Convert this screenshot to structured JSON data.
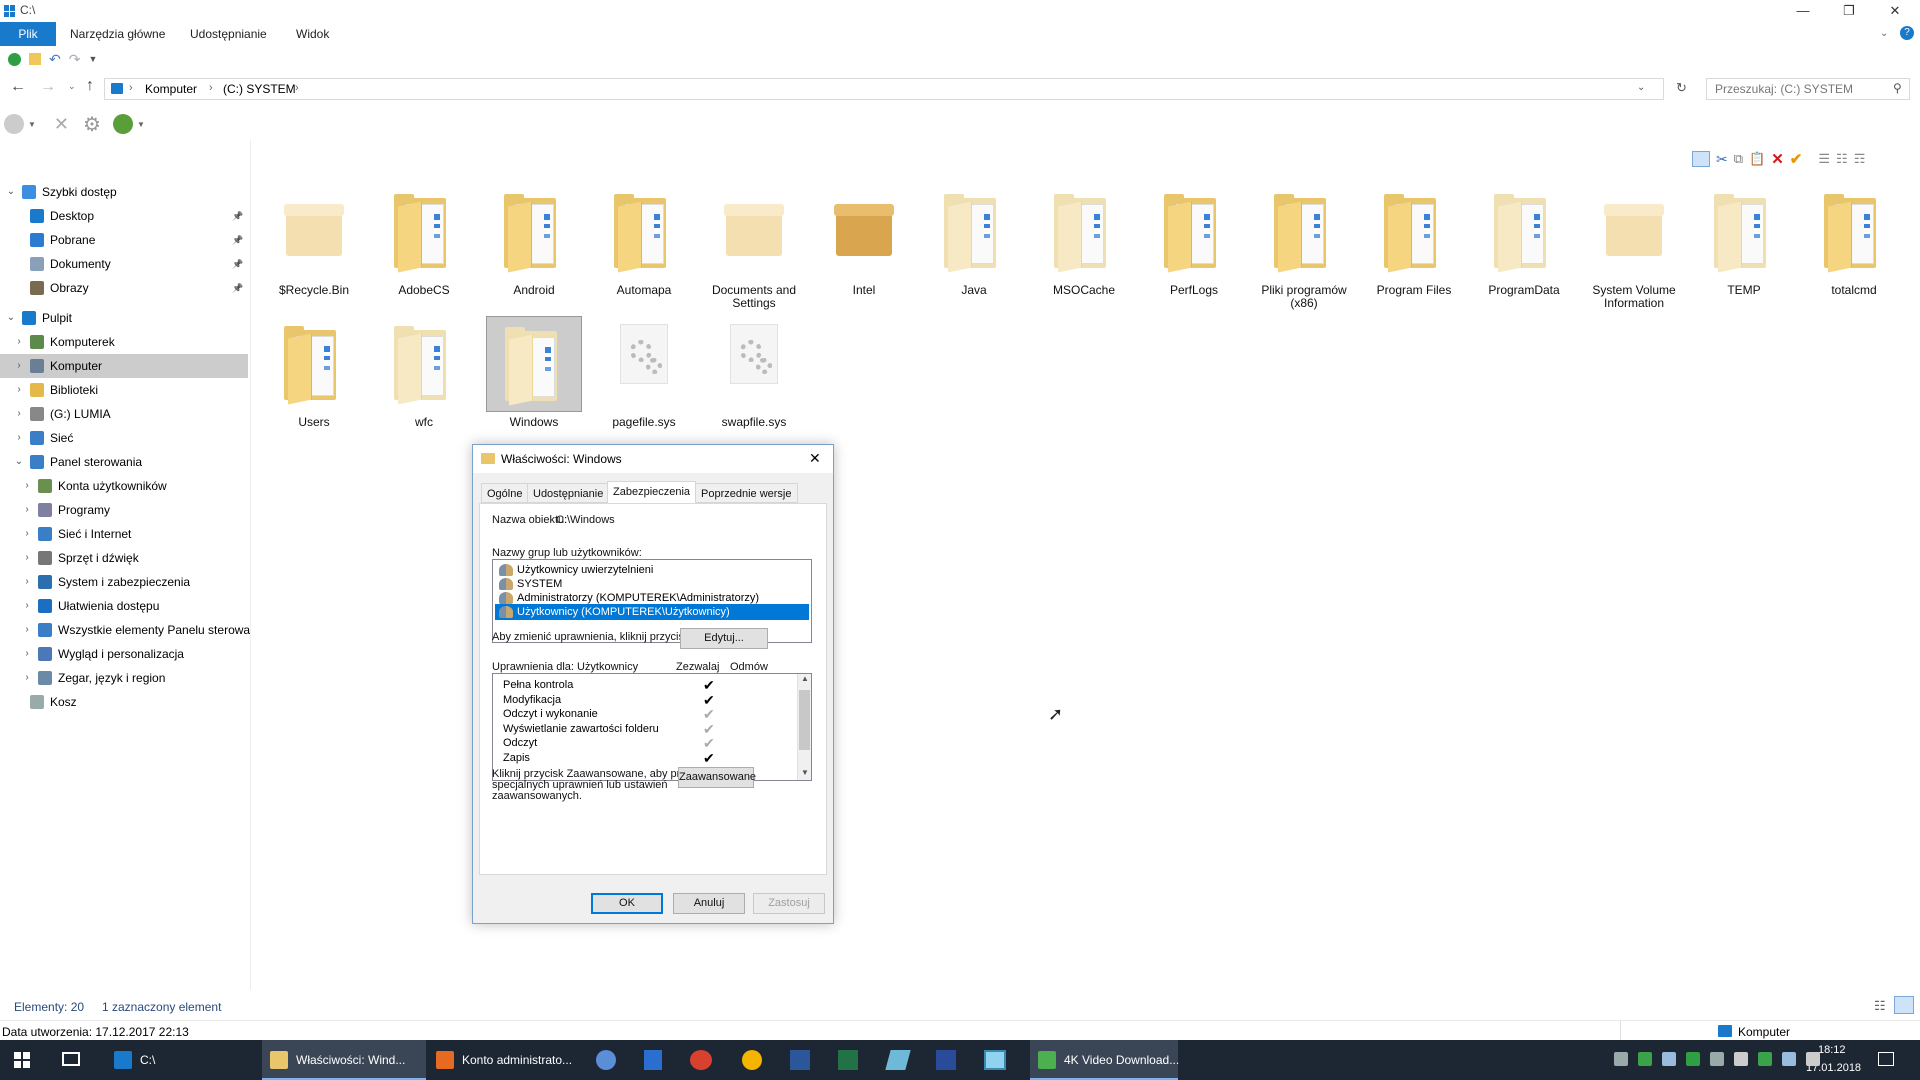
{
  "window": {
    "title": "C:\\",
    "minimize": "—",
    "restore": "❐",
    "close": "✕"
  },
  "ribbon": {
    "tabs": [
      "Plik",
      "Narzędzia główne",
      "Udostępnianie",
      "Widok"
    ]
  },
  "address": {
    "path": [
      "Komputer",
      "(C:) SYSTEM"
    ],
    "search_placeholder": "Przeszukaj: (C:) SYSTEM"
  },
  "nav": [
    {
      "label": "Szybki dostęp",
      "level": 0,
      "exp": "open",
      "color": "#3b8ee0"
    },
    {
      "label": "Desktop",
      "level": 1,
      "pin": true,
      "color": "#1979ca"
    },
    {
      "label": "Pobrane",
      "level": 1,
      "pin": true,
      "color": "#2b7bd3"
    },
    {
      "label": "Dokumenty",
      "level": 1,
      "pin": true,
      "color": "#8aa0b8"
    },
    {
      "label": "Obrazy",
      "level": 1,
      "pin": true,
      "color": "#7a6a50"
    },
    {
      "label": "Pulpit",
      "level": 0,
      "exp": "open",
      "color": "#1979ca",
      "gap": true
    },
    {
      "label": "Komputerek",
      "level": 1,
      "exp": "closed",
      "color": "#5b8a4a"
    },
    {
      "label": "Komputer",
      "level": 1,
      "exp": "closed",
      "color": "#6a7f95",
      "sel": true
    },
    {
      "label": "Biblioteki",
      "level": 1,
      "exp": "closed",
      "color": "#e5b84a"
    },
    {
      "label": "(G:) LUMIA",
      "level": 1,
      "exp": "closed",
      "color": "#888"
    },
    {
      "label": "Sieć",
      "level": 1,
      "exp": "closed",
      "color": "#3b7ec8"
    },
    {
      "label": "Panel sterowania",
      "level": 1,
      "exp": "open",
      "color": "#3b7ec8"
    },
    {
      "label": "Konta użytkowników",
      "level": 2,
      "exp": "closed",
      "color": "#6b8f4e"
    },
    {
      "label": "Programy",
      "level": 2,
      "exp": "closed",
      "color": "#7f7f9f"
    },
    {
      "label": "Sieć i Internet",
      "level": 2,
      "exp": "closed",
      "color": "#3b7ec8"
    },
    {
      "label": "Sprzęt i dźwięk",
      "level": 2,
      "exp": "closed",
      "color": "#777"
    },
    {
      "label": "System i zabezpieczenia",
      "level": 2,
      "exp": "closed",
      "color": "#2b6fb0"
    },
    {
      "label": "Ułatwienia dostępu",
      "level": 2,
      "exp": "closed",
      "color": "#1b6ec2"
    },
    {
      "label": "Wszystkie elementy Panelu sterowa",
      "level": 2,
      "exp": "closed",
      "color": "#3b7ec8"
    },
    {
      "label": "Wygląd i personalizacja",
      "level": 2,
      "exp": "closed",
      "color": "#4a78b8"
    },
    {
      "label": "Zegar, język i region",
      "level": 2,
      "exp": "closed",
      "color": "#6a8aa8"
    },
    {
      "label": "Kosz",
      "level": 1,
      "color": "#9aa"
    }
  ],
  "files": [
    {
      "name": "$Recycle.Bin",
      "kind": "box"
    },
    {
      "name": "AdobeCS",
      "kind": "folder"
    },
    {
      "name": "Android",
      "kind": "folder"
    },
    {
      "name": "Automapa",
      "kind": "folder"
    },
    {
      "name": "Documents and Settings",
      "kind": "box"
    },
    {
      "name": "Intel",
      "kind": "boxdark"
    },
    {
      "name": "Java",
      "kind": "folderpale"
    },
    {
      "name": "MSOCache",
      "kind": "folderpale"
    },
    {
      "name": "PerfLogs",
      "kind": "folder"
    },
    {
      "name": "Pliki programów (x86)",
      "kind": "folder"
    },
    {
      "name": "Program Files",
      "kind": "folder"
    },
    {
      "name": "ProgramData",
      "kind": "folderpale"
    },
    {
      "name": "System Volume Information",
      "kind": "box"
    },
    {
      "name": "TEMP",
      "kind": "folderpale"
    },
    {
      "name": "totalcmd",
      "kind": "folder"
    },
    {
      "name": "Users",
      "kind": "folder"
    },
    {
      "name": "wfc",
      "kind": "folderpale"
    },
    {
      "name": "Windows",
      "kind": "folderpale",
      "sel": true
    },
    {
      "name": "pagefile.sys",
      "kind": "gear"
    },
    {
      "name": "swapfile.sys",
      "kind": "gear"
    }
  ],
  "dialog": {
    "title": "Właściwości: Windows",
    "close": "✕",
    "tabs": [
      "Ogólne",
      "Udostępnianie",
      "Zabezpieczenia",
      "Poprzednie wersje"
    ],
    "object_label": "Nazwa obiektu:",
    "object_value": "C:\\Windows",
    "groups_label": "Nazwy grup lub użytkowników:",
    "groups": [
      "Użytkownicy uwierzytelnieni",
      "SYSTEM",
      "Administratorzy (KOMPUTEREK\\Administratorzy)",
      "Użytkownicy (KOMPUTEREK\\Użytkownicy)"
    ],
    "change_text": "Aby zmienić uprawnienia, kliknij przycisk Edytuj.",
    "edit_btn": "Edytuj...",
    "perm_label": "Uprawnienia dla: Użytkownicy",
    "allow": "Zezwalaj",
    "deny": "Odmów",
    "perms": [
      {
        "name": "Pełna kontrola",
        "check": "✔",
        "gray": false
      },
      {
        "name": "Modyfikacja",
        "check": "✔",
        "gray": false
      },
      {
        "name": "Odczyt i wykonanie",
        "check": "✔",
        "gray": true
      },
      {
        "name": "Wyświetlanie zawartości folderu",
        "check": "✔",
        "gray": true
      },
      {
        "name": "Odczyt",
        "check": "✔",
        "gray": true
      },
      {
        "name": "Zapis",
        "check": "✔",
        "gray": false
      }
    ],
    "adv_text": [
      "Kliknij przycisk Zaawansowane, aby przejść do",
      "specjalnych uprawnień lub ustawień",
      "zaawansowanych."
    ],
    "adv_btn": "Zaawansowane",
    "ok": "OK",
    "cancel": "Anuluj",
    "apply": "Zastosuj"
  },
  "status": {
    "count": "Elementy: 20",
    "selected": "1 zaznaczony element",
    "created": "Data utworzenia: 17.12.2017 22:13",
    "location": "Komputer"
  },
  "taskbar": {
    "items": [
      {
        "label": "C:\\",
        "color": "#1979ca"
      },
      {
        "label": "Właściwości: Wind...",
        "color": "#e9c66b",
        "active": true
      },
      {
        "label": "Konto administrato...",
        "color": "#e66a22"
      },
      {
        "label": "4K Video Download...",
        "color": "#4caf50",
        "active": true
      }
    ],
    "time": "18:12",
    "date": "17.01.2018"
  }
}
